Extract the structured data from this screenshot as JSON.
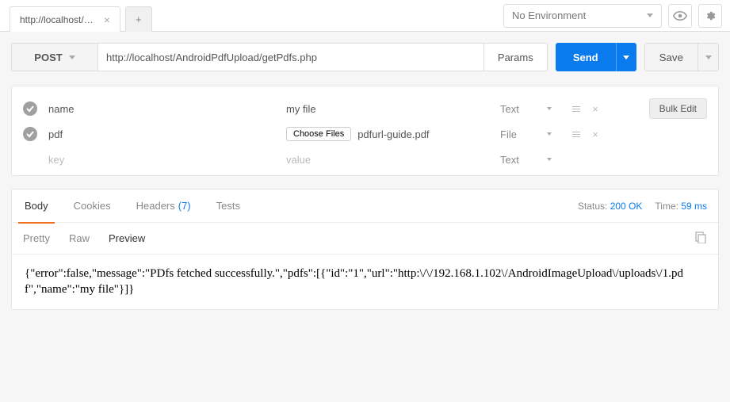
{
  "tab": {
    "title": "http://localhost/Andro"
  },
  "env": {
    "label": "No Environment"
  },
  "request": {
    "method": "POST",
    "url": "http://localhost/AndroidPdfUpload/getPdfs.php",
    "params_btn": "Params",
    "send": "Send",
    "save": "Save"
  },
  "body_params": {
    "rows": [
      {
        "key": "name",
        "value": "my file",
        "type": "Text"
      },
      {
        "key": "pdf",
        "file_btn": "Choose Files",
        "file_name": "pdfurl-guide.pdf",
        "type": "File"
      }
    ],
    "placeholder": {
      "key": "key",
      "value": "value",
      "type": "Text"
    },
    "bulk_edit": "Bulk Edit"
  },
  "response": {
    "tabs": {
      "body": "Body",
      "cookies": "Cookies",
      "headers": "Headers",
      "headers_count": "(7)",
      "tests": "Tests"
    },
    "status_label": "Status:",
    "status_value": "200 OK",
    "time_label": "Time:",
    "time_value": "59 ms",
    "views": {
      "pretty": "Pretty",
      "raw": "Raw",
      "preview": "Preview"
    },
    "body_text": "{\"error\":false,\"message\":\"PDfs fetched successfully.\",\"pdfs\":[{\"id\":\"1\",\"url\":\"http:\\/\\/192.168.1.102\\/AndroidImageUpload\\/uploads\\/1.pdf\",\"name\":\"my file\"}]}"
  }
}
